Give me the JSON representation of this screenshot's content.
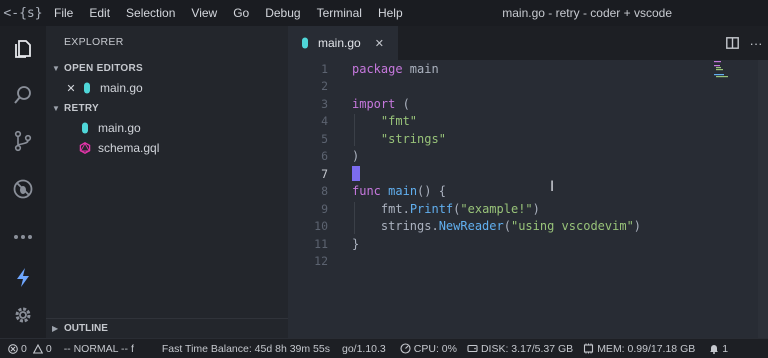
{
  "menu": [
    "File",
    "Edit",
    "Selection",
    "View",
    "Go",
    "Debug",
    "Terminal",
    "Help"
  ],
  "window_title": "main.go - retry - coder + vscode",
  "sidebar": {
    "title": "EXPLORER",
    "open_editors_label": "OPEN EDITORS",
    "open_editors": [
      {
        "name": "main.go"
      }
    ],
    "folder_label": "RETRY",
    "folder_files": [
      {
        "name": "main.go"
      },
      {
        "name": "schema.gql"
      }
    ],
    "outline_label": "OUTLINE"
  },
  "tab": {
    "label": "main.go"
  },
  "editor": {
    "line_numbers": [
      "1",
      "2",
      "3",
      "4",
      "5",
      "6",
      "7",
      "8",
      "9",
      "10",
      "11",
      "12"
    ],
    "active_line": 7,
    "code": {
      "l1_kw": "package",
      "l1_rest": " main",
      "l3_kw": "import",
      "l3_rest": " (",
      "l4_str": "\"fmt\"",
      "l5_str": "\"strings\"",
      "l6": ")",
      "l8_kw": "func",
      "l8_fn": "main",
      "l8_rest": "() {",
      "l9_pkg": "fmt.",
      "l9_fn": "Printf",
      "l9_open": "(",
      "l9_str": "\"example!\"",
      "l9_close": ")",
      "l10_pkg": "strings.",
      "l10_fn": "NewReader",
      "l10_open": "(",
      "l10_str": "\"using vscodevim\"",
      "l10_close": ")",
      "l11": "}"
    }
  },
  "status": {
    "errors": "0",
    "warnings": "0",
    "vim_mode": "-- NORMAL -- f",
    "balance": "Fast Time Balance: 45d 8h 39m 55s",
    "go_version": "go/1.10.3",
    "cpu": "CPU: 0%",
    "disk": "DISK: 3.17/5.37 GB",
    "mem": "MEM: 0.99/17.18 GB",
    "notifications": "1"
  },
  "colors": {
    "accent": "#7c6cf0",
    "keyword": "#c678dd",
    "string": "#98c379",
    "function": "#61afef",
    "go_file": "#4fd6d8",
    "gql_file": "#e535ab",
    "bolt": "#6ea6ff"
  }
}
